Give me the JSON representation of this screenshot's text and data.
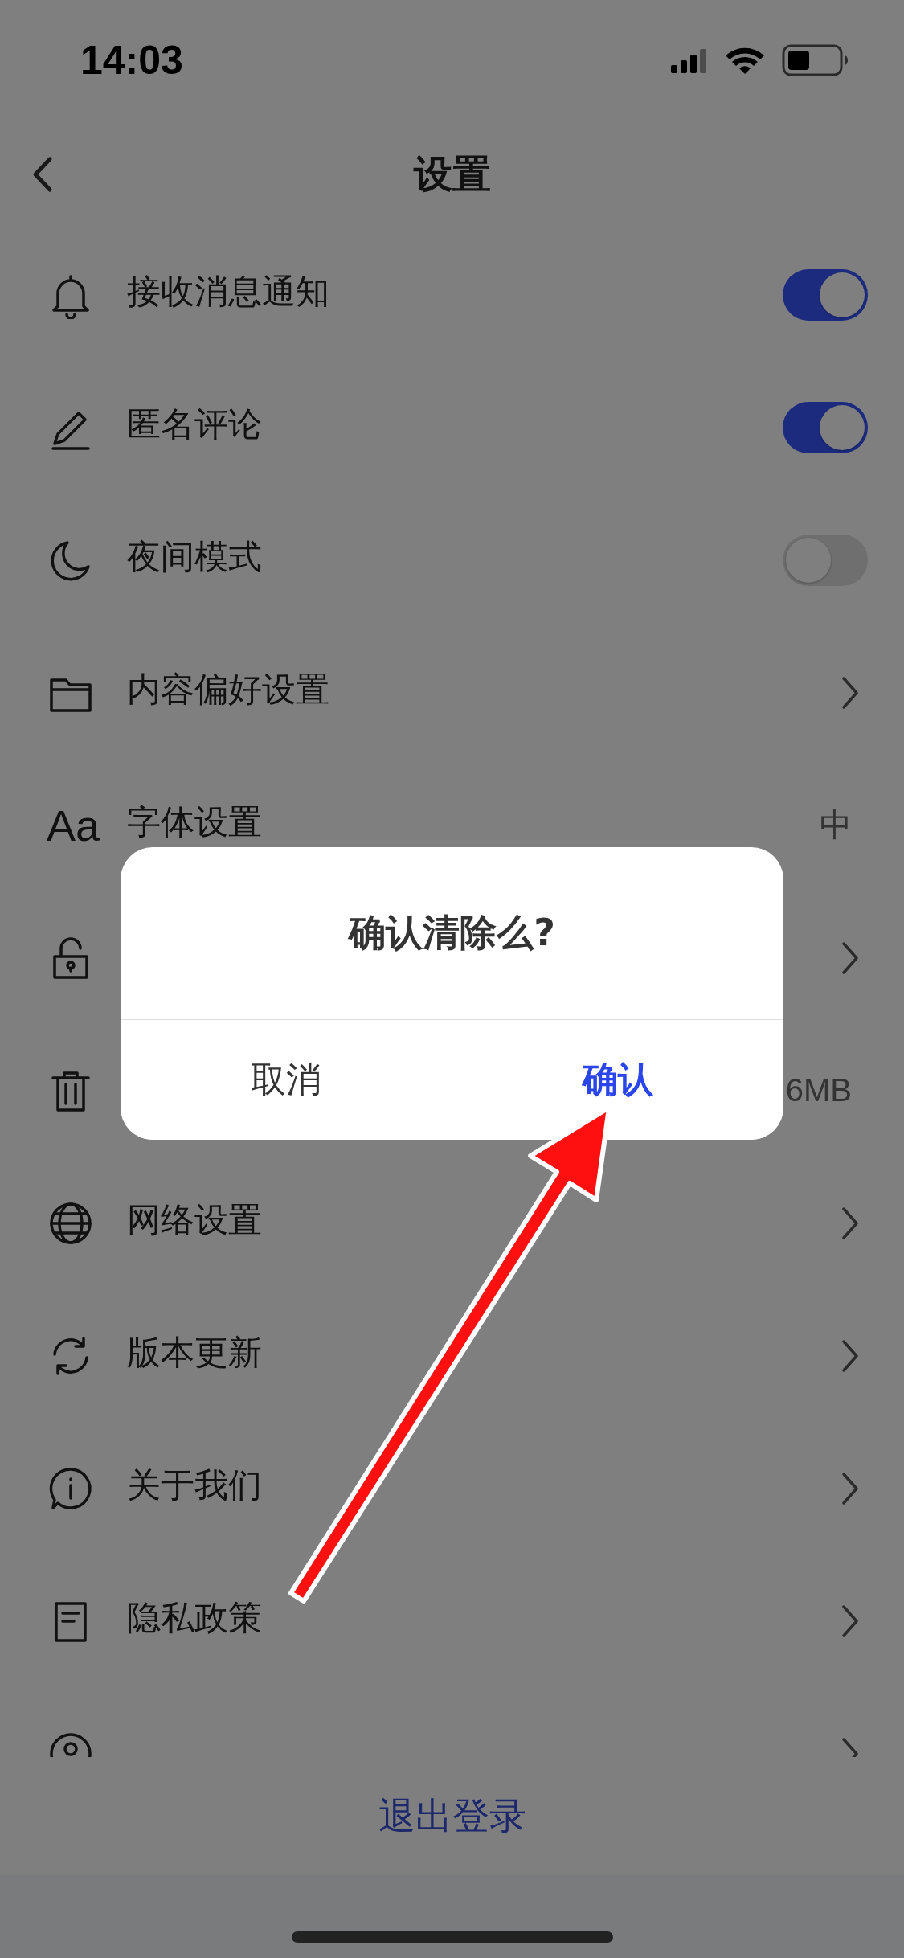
{
  "status_bar": {
    "time": "14:03"
  },
  "nav": {
    "title": "设置"
  },
  "rows": [
    {
      "kind": "toggle",
      "label": "接收消息通知",
      "on": true
    },
    {
      "kind": "toggle",
      "label": "匿名评论",
      "on": true
    },
    {
      "kind": "toggle",
      "label": "夜间模式",
      "on": false
    },
    {
      "kind": "link",
      "label": "内容偏好设置"
    },
    {
      "kind": "value",
      "icon_text": "Aa",
      "label": "字体设置",
      "value": "中"
    },
    {
      "kind": "link"
    },
    {
      "kind": "value",
      "value": "6MB"
    },
    {
      "kind": "link",
      "label": "网络设置"
    },
    {
      "kind": "link",
      "label": "版本更新"
    },
    {
      "kind": "link",
      "label": "关于我们"
    },
    {
      "kind": "link",
      "label": "隐私政策"
    },
    {
      "kind": "link"
    }
  ],
  "logout": {
    "label": "退出登录"
  },
  "dialog": {
    "title": "确认清除么?",
    "buttons": [
      {
        "label": "取消",
        "kind": "cancel"
      },
      {
        "label": "确认",
        "kind": "confirm"
      }
    ]
  }
}
